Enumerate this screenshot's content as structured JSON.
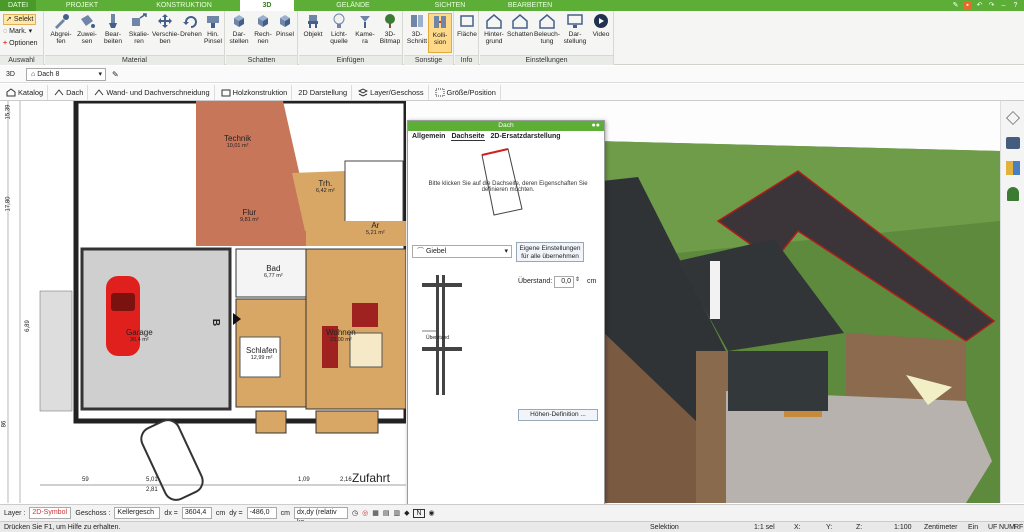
{
  "menu_tabs": [
    "DATEI",
    "PROJEKT",
    "KONSTRUKTION",
    "3D",
    "GELÄNDE",
    "SICHTEN",
    "BEARBEITEN"
  ],
  "ribbon": {
    "auswahl": {
      "select": "Selekt",
      "mark": "Mark.",
      "options": "Optionen",
      "title": "Auswahl"
    },
    "material": {
      "title": "Material",
      "buttons": [
        "Abgrei-\nfen",
        "Zuwei-\nsen",
        "Bear-\nbeiten",
        "Skalie-\nren",
        "Verschie-\nben",
        "Drehen",
        "Hin.\nPinsel"
      ]
    },
    "schatten": {
      "title": "Schatten",
      "buttons": [
        "Dar-\nstellen",
        "Rech-\nnen",
        "Pinsel"
      ]
    },
    "einfuegen": {
      "title": "Einfügen",
      "buttons": [
        "Objekt",
        "Licht-\nquelle",
        "Kame-\nra",
        "3D-\nBitmap"
      ]
    },
    "sonstige": {
      "title": "Sonstige",
      "buttons": [
        "3D-\nSchnitt",
        "Kolli-\nsion"
      ]
    },
    "info": {
      "title": "Info",
      "buttons": [
        "Fläche"
      ]
    },
    "einstellungen": {
      "title": "Einstellungen",
      "buttons": [
        "Hinter-\ngrund",
        "Schatten",
        "Beleuch-\ntung",
        "Dar-\nstellung",
        "Video"
      ]
    }
  },
  "toolbar2": {
    "mode": "3D",
    "selection": "Dach 8"
  },
  "toolbar3": [
    "Katalog",
    "Dach",
    "Wand- und Dachverschneidung",
    "Holzkonstruktion",
    "2D Darstellung",
    "Layer/Geschoss",
    "Größe/Position"
  ],
  "plan": {
    "rooms": [
      {
        "name": "Technik",
        "area": "10,01 m²"
      },
      {
        "name": "Flur",
        "area": "9,81 m²"
      },
      {
        "name": "Trh.",
        "area": "6,42 m²"
      },
      {
        "name": "Ar",
        "area": "5,21 m²"
      },
      {
        "name": "Bad",
        "area": "6,77 m²"
      },
      {
        "name": "Garage",
        "area": "30,4 m²"
      },
      {
        "name": "Wohnen",
        "area": "23,00 m²"
      },
      {
        "name": "Schlafen",
        "area": "12,99 m²"
      }
    ],
    "dims_left": [
      "15,39",
      "17,80",
      "6,89",
      "86"
    ],
    "dims_bottom": [
      "59",
      "5,01",
      "2,81",
      "1,09",
      "2,16"
    ],
    "label_b": "B",
    "label_zufahrt": "Zufahrt"
  },
  "dialog": {
    "title": "Dach",
    "tabs": [
      "Allgemein",
      "Dachseite",
      "2D-Ersatzdarstellung"
    ],
    "instruction": "Bitte klicken Sie auf die Dachseite, deren Eigenschaften Sie definieren möchten.",
    "side_type": "Giebel",
    "own_settings_btn": "Eigene Einstellungen für alle übernehmen",
    "overhang_label": "Überstand:",
    "overhang_value": "0,0",
    "overhang_unit": "cm",
    "diagram_label": "Überstand",
    "height_btn": "Höhen-Definition ..."
  },
  "bottom_bar": {
    "layer_label": "Layer :",
    "layer_value": "2D-Symbol",
    "floor_label": "Geschoss :",
    "floor_value": "Kellergesch",
    "dx_label": "dx =",
    "dx_value": "3604,4",
    "dy_label": "dy =",
    "dy_value": "-486,0",
    "unit": "cm",
    "rel": "dx,dy (relativ ka"
  },
  "status": {
    "help": "Drücken Sie F1, um Hilfe zu erhalten.",
    "mode": "Selektion",
    "scale_sel": "1:1 sel",
    "x": "X:",
    "y": "Y:",
    "z": "Z:",
    "scale": "1:100",
    "unit": "Zentimeter",
    "ein": "Ein",
    "uf": "UF",
    "num": "NUM",
    "rf": "RF"
  },
  "colors": {
    "green": "#5cae36",
    "brick": "#c8765a",
    "wood": "#d6a35a"
  }
}
